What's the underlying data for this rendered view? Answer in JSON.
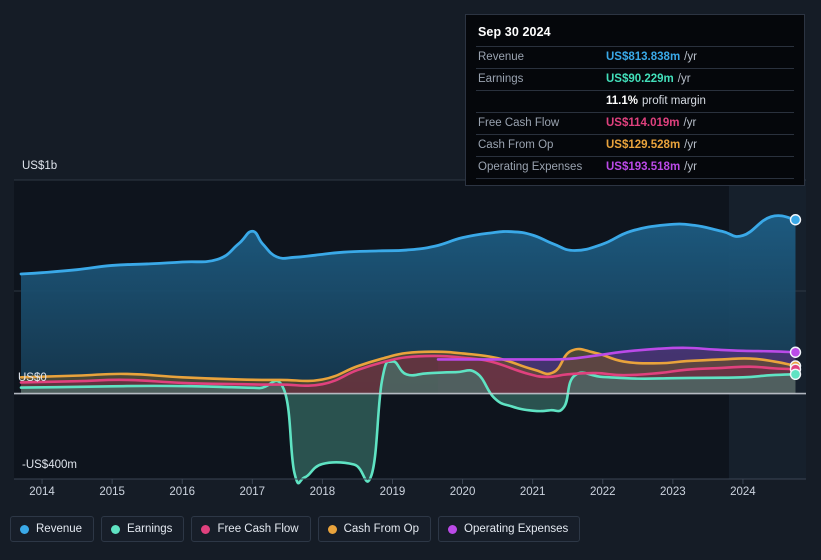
{
  "theme": {
    "background": "#151c26",
    "plot_background": "#0e141d",
    "forecast_background": "#17222f",
    "grid": "#2e3744",
    "zero_line": "#c9ced6",
    "axis_text": "#dfe4ec"
  },
  "tooltip": {
    "date": "Sep 30 2024",
    "rows": [
      {
        "label": "Revenue",
        "value": "US$813.838m",
        "unit": "/yr",
        "color": "#3aa9e8"
      },
      {
        "label": "Earnings",
        "value": "US$90.229m",
        "unit": "/yr",
        "color": "#42dfba"
      },
      {
        "label": "",
        "value": "11.1%",
        "unit": "profit margin",
        "color": "#ffffff",
        "is_margin": true
      },
      {
        "label": "Free Cash Flow",
        "value": "US$114.019m",
        "unit": "/yr",
        "color": "#e0417e"
      },
      {
        "label": "Cash From Op",
        "value": "US$129.528m",
        "unit": "/yr",
        "color": "#e9a33c"
      },
      {
        "label": "Operating Expenses",
        "value": "US$193.518m",
        "unit": "/yr",
        "color": "#bb4ae8"
      }
    ]
  },
  "axis": {
    "y_labels": [
      {
        "text": "US$1b",
        "y": 160
      },
      {
        "text": "US$0",
        "y": 372
      },
      {
        "text": "-US$400m",
        "y": 459
      }
    ],
    "x_labels": [
      "2014",
      "2015",
      "2016",
      "2017",
      "2018",
      "2019",
      "2020",
      "2021",
      "2022",
      "2023",
      "2024"
    ]
  },
  "legend": {
    "items": [
      {
        "label": "Revenue",
        "color": "#3aa9e8"
      },
      {
        "label": "Earnings",
        "color": "#5fe3c3"
      },
      {
        "label": "Free Cash Flow",
        "color": "#e0417e"
      },
      {
        "label": "Cash From Op",
        "color": "#e9a33c"
      },
      {
        "label": "Operating Expenses",
        "color": "#bb4ae8"
      }
    ]
  },
  "chart_data": {
    "type": "area",
    "title": "",
    "xlabel": "",
    "ylabel": "",
    "currency": "USD",
    "units": "millions per year",
    "grid": true,
    "legend_position": "bottom-left",
    "xlim": [
      2013.6,
      2024.9
    ],
    "ylim": [
      -400,
      1000
    ],
    "x_ticks": [
      2014,
      2015,
      2016,
      2017,
      2018,
      2019,
      2020,
      2021,
      2022,
      2023,
      2024
    ],
    "y_ticks": [
      -400,
      0,
      1000
    ],
    "y_tick_labels": [
      "-US$400m",
      "US$0",
      "US$1b"
    ],
    "forecast_start": 2023.8,
    "opex_start": 2019.65,
    "series": [
      {
        "name": "Revenue",
        "color": "#3aa9e8",
        "fill": "#1b4766",
        "x": [
          2013.7,
          2014.0,
          2014.5,
          2015.0,
          2015.5,
          2016.0,
          2016.5,
          2016.8,
          2017.0,
          2017.15,
          2017.35,
          2017.6,
          2017.9,
          2018.3,
          2018.8,
          2019.2,
          2019.6,
          2020.0,
          2020.4,
          2020.7,
          2021.0,
          2021.3,
          2021.6,
          2022.0,
          2022.4,
          2022.9,
          2023.3,
          2023.7,
          2024.0,
          2024.4,
          2024.75
        ],
        "y": [
          560,
          566,
          580,
          600,
          607,
          616,
          628,
          700,
          760,
          700,
          640,
          638,
          648,
          662,
          668,
          672,
          690,
          730,
          752,
          758,
          742,
          700,
          670,
          700,
          760,
          790,
          788,
          760,
          740,
          828,
          813.838
        ]
      },
      {
        "name": "Earnings",
        "color": "#5fe3c3",
        "fill": "#3f7f74",
        "x": [
          2013.7,
          2014.2,
          2015.0,
          2015.6,
          2016.2,
          2016.7,
          2017.1,
          2017.45,
          2017.6,
          2017.75,
          2018.0,
          2018.45,
          2018.7,
          2018.85,
          2019.0,
          2019.2,
          2019.5,
          2019.9,
          2020.2,
          2020.45,
          2020.7,
          2021.0,
          2021.25,
          2021.45,
          2021.6,
          2022.0,
          2022.5,
          2023.0,
          2023.5,
          2024.0,
          2024.4,
          2024.75
        ],
        "y": [
          28,
          30,
          34,
          36,
          34,
          30,
          26,
          20,
          -370,
          -392,
          -330,
          -332,
          -382,
          60,
          150,
          90,
          95,
          100,
          96,
          -20,
          -60,
          -80,
          -78,
          -62,
          85,
          78,
          70,
          72,
          74,
          76,
          86,
          90.229
        ]
      },
      {
        "name": "Free Cash Flow",
        "color": "#e0417e",
        "fill": "#6d2a45",
        "x": [
          2013.7,
          2014.5,
          2015.2,
          2016.0,
          2016.8,
          2017.4,
          2018.0,
          2018.5,
          2018.9,
          2019.2,
          2019.6,
          2020.0,
          2020.4,
          2020.9,
          2021.2,
          2021.5,
          2021.9,
          2022.3,
          2022.8,
          2023.2,
          2023.7,
          2024.1,
          2024.45,
          2024.75
        ],
        "y": [
          52,
          58,
          64,
          50,
          44,
          42,
          44,
          110,
          150,
          170,
          176,
          168,
          150,
          96,
          78,
          90,
          96,
          86,
          96,
          112,
          120,
          126,
          118,
          114.019
        ]
      },
      {
        "name": "Cash From Op",
        "color": "#e9a33c",
        "fill": "#6b5026",
        "x": [
          2013.7,
          2014.5,
          2015.2,
          2016.0,
          2016.8,
          2017.4,
          2018.0,
          2018.5,
          2018.9,
          2019.2,
          2019.6,
          2020.0,
          2020.5,
          2021.0,
          2021.3,
          2021.55,
          2021.9,
          2022.3,
          2022.8,
          2023.2,
          2023.7,
          2024.1,
          2024.45,
          2024.75
        ],
        "y": [
          76,
          84,
          92,
          76,
          66,
          64,
          66,
          128,
          168,
          190,
          196,
          188,
          166,
          114,
          100,
          200,
          190,
          150,
          142,
          152,
          160,
          164,
          150,
          129.528
        ]
      },
      {
        "name": "Operating Expenses",
        "color": "#bb4ae8",
        "fill": "#56307a",
        "x": [
          2019.65,
          2020.0,
          2020.6,
          2021.1,
          2021.5,
          2021.9,
          2022.3,
          2022.8,
          2023.2,
          2023.6,
          2024.0,
          2024.4,
          2024.75
        ],
        "y": [
          160,
          160,
          160,
          160,
          162,
          178,
          196,
          210,
          214,
          206,
          200,
          198,
          193.518
        ]
      }
    ],
    "end_markers": [
      {
        "name": "Revenue",
        "value": 813.838,
        "color": "#3aa9e8"
      },
      {
        "name": "Operating Expenses",
        "value": 193.518,
        "color": "#bb4ae8"
      },
      {
        "name": "Cash From Op",
        "value": 129.528,
        "color": "#e9a33c"
      },
      {
        "name": "Free Cash Flow",
        "value": 114.019,
        "color": "#e0417e"
      },
      {
        "name": "Earnings",
        "value": 90.229,
        "color": "#5fe3c3"
      }
    ]
  }
}
